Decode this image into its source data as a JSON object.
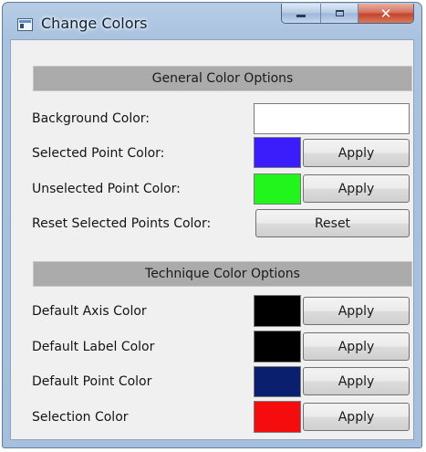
{
  "window": {
    "title": "Change Colors",
    "close_glyph": "✕"
  },
  "general": {
    "header": "General Color Options",
    "background_label": "Background Color:",
    "background_color": "#ffffff",
    "selected_label": "Selected Point Color:",
    "selected_color": "#3a1dfa",
    "selected_apply": "Apply",
    "unselected_label": "Unselected Point Color:",
    "unselected_color": "#22f51c",
    "unselected_apply": "Apply",
    "reset_label": "Reset Selected Points Color:",
    "reset_button": "Reset"
  },
  "technique": {
    "header": "Technique Color Options",
    "rows": [
      {
        "label": "Default Axis Color",
        "color": "#000000",
        "apply": "Apply"
      },
      {
        "label": "Default Label Color",
        "color": "#000000",
        "apply": "Apply"
      },
      {
        "label": "Default Point Color",
        "color": "#0a1f6e",
        "apply": "Apply"
      },
      {
        "label": "Selection Color",
        "color": "#f50c0c",
        "apply": "Apply"
      }
    ]
  }
}
